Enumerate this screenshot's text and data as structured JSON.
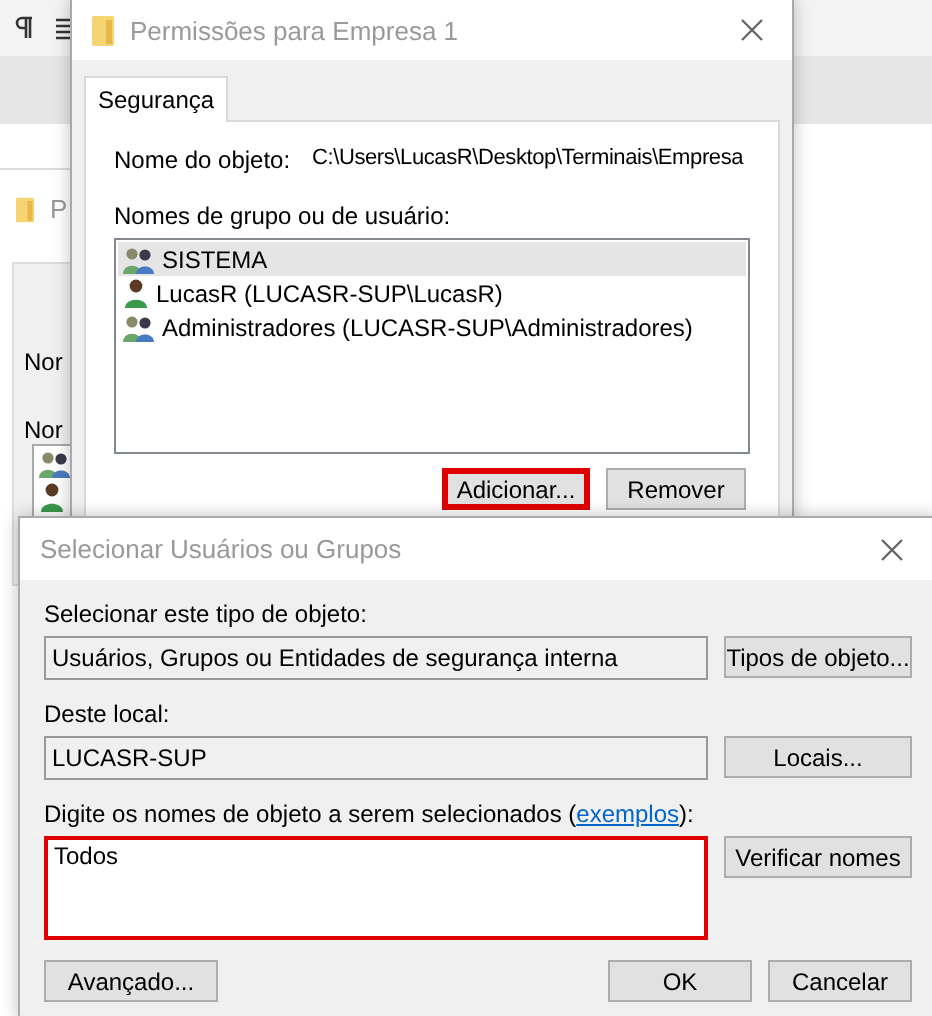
{
  "background": {
    "window_title": "P",
    "labels": [
      "Nor",
      "Nor"
    ]
  },
  "permissions_dialog": {
    "title": "Permissões para Empresa 1",
    "tabs": [
      {
        "label": "Segurança",
        "selected": true
      }
    ],
    "object_name_label": "Nome do objeto:",
    "object_name": "C:\\Users\\LucasR\\Desktop\\Terminais\\Empresa",
    "list_label": "Nomes de grupo ou de usuário:",
    "principals": [
      {
        "kind": "group",
        "name": "SISTEMA",
        "selected": true
      },
      {
        "kind": "user",
        "name": "LucasR (LUCASR-SUP\\LucasR)",
        "selected": false
      },
      {
        "kind": "group",
        "name": "Administradores (LUCASR-SUP\\Administradores)",
        "selected": false
      }
    ],
    "buttons": [
      {
        "label": "Adicionar...",
        "highlighted": true
      },
      {
        "label": "Remover",
        "highlighted": false
      }
    ]
  },
  "select_dialog": {
    "title": "Selecionar Usuários ou Grupos",
    "object_type_label": "Selecionar este tipo de objeto:",
    "object_type": "Usuários, Grupos ou Entidades de segurança interna",
    "object_type_button": "Tipos de objeto...",
    "location_label": "Deste local:",
    "location": "LUCASR-SUP",
    "location_button": "Locais...",
    "names_label": "Digite os nomes de objeto a serem selecionados (",
    "names_link": "exemplos",
    "names_label_end": "):",
    "names_value": "Todos",
    "names_highlighted": true,
    "check_button": "Verificar nomes",
    "advanced_button": "Avançado...",
    "ok_button": "OK",
    "cancel_button": "Cancelar"
  }
}
